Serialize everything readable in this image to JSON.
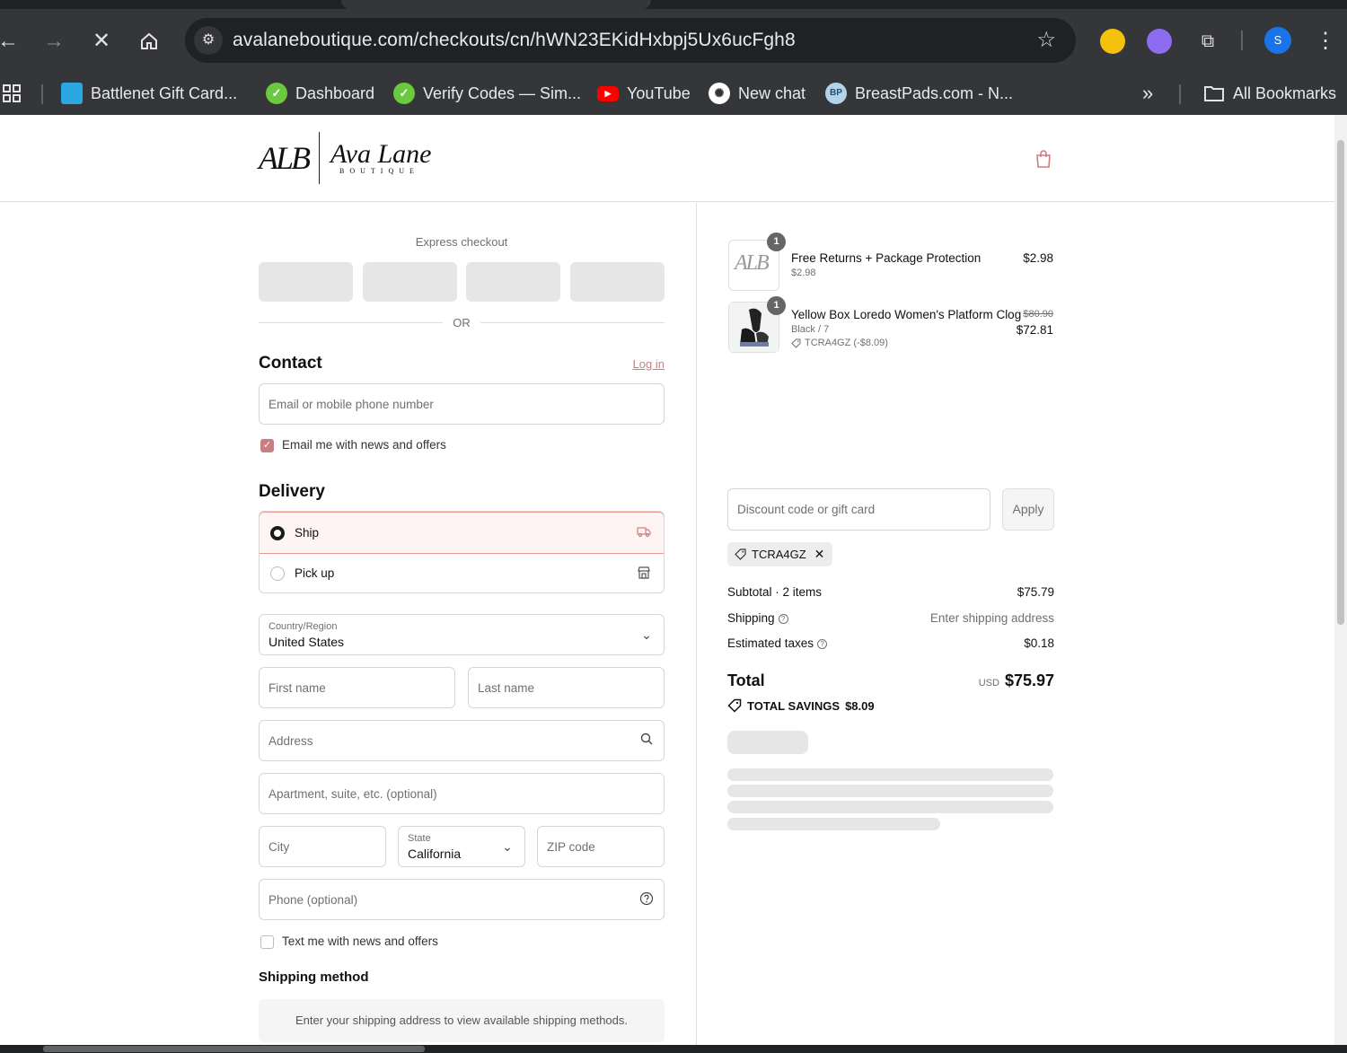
{
  "browser": {
    "url": "avalaneboutique.com/checkouts/cn/hWN23EKidHxbpj5Ux6ucFgh8",
    "profile_initial": "S",
    "bookmarks": [
      {
        "label": "Battlenet Gift Card..."
      },
      {
        "label": "Dashboard"
      },
      {
        "label": "Verify Codes — Sim..."
      },
      {
        "label": "YouTube"
      },
      {
        "label": "New chat"
      },
      {
        "label": "BreastPads.com - N..."
      }
    ],
    "all_bookmarks_label": "All Bookmarks",
    "more_chevron": "»"
  },
  "brand": {
    "monogram": "ALB",
    "script_name": "Ava Lane",
    "subtitle": "BOUTIQUE",
    "accent_color": "#c97f7f"
  },
  "express": {
    "label": "Express checkout",
    "or_text": "OR"
  },
  "contact": {
    "heading": "Contact",
    "login_link": "Log in",
    "email_placeholder": "Email or mobile phone number",
    "news_checkbox_label": "Email me with news and offers",
    "news_checked": true
  },
  "delivery": {
    "heading": "Delivery",
    "options": [
      {
        "label": "Ship",
        "selected": true,
        "icon": "truck-icon"
      },
      {
        "label": "Pick up",
        "selected": false,
        "icon": "store-icon"
      }
    ],
    "country_label": "Country/Region",
    "country_value": "United States",
    "first_name_placeholder": "First name",
    "last_name_placeholder": "Last name",
    "address_placeholder": "Address",
    "apartment_placeholder": "Apartment, suite, etc. (optional)",
    "city_placeholder": "City",
    "state_label": "State",
    "state_value": "California",
    "zip_placeholder": "ZIP code",
    "phone_placeholder": "Phone (optional)",
    "text_checkbox_label": "Text me with news and offers",
    "text_checked": false
  },
  "shipping_method": {
    "heading": "Shipping method",
    "notice": "Enter your shipping address to view available shipping methods."
  },
  "summary": {
    "items": [
      {
        "qty": "1",
        "thumb_text": "ALB",
        "title": "Free Returns + Package Protection",
        "subtitle": "$2.98",
        "price": "$2.98"
      },
      {
        "qty": "1",
        "title": "Yellow Box Loredo Women's Platform Clog",
        "variant": "Black / 7",
        "discount_line": "TCRA4GZ (-$8.09)",
        "original_price": "$80.90",
        "price": "$72.81"
      }
    ],
    "discount_placeholder": "Discount code or gift card",
    "apply_label": "Apply",
    "applied_code": "TCRA4GZ",
    "subtotal_label": "Subtotal · 2 items",
    "subtotal_value": "$75.79",
    "shipping_label": "Shipping",
    "shipping_value": "Enter shipping address",
    "taxes_label": "Estimated taxes",
    "taxes_value": "$0.18",
    "total_label": "Total",
    "currency": "USD",
    "total_value": "$75.97",
    "savings_label": "TOTAL SAVINGS",
    "savings_value": "$8.09"
  }
}
